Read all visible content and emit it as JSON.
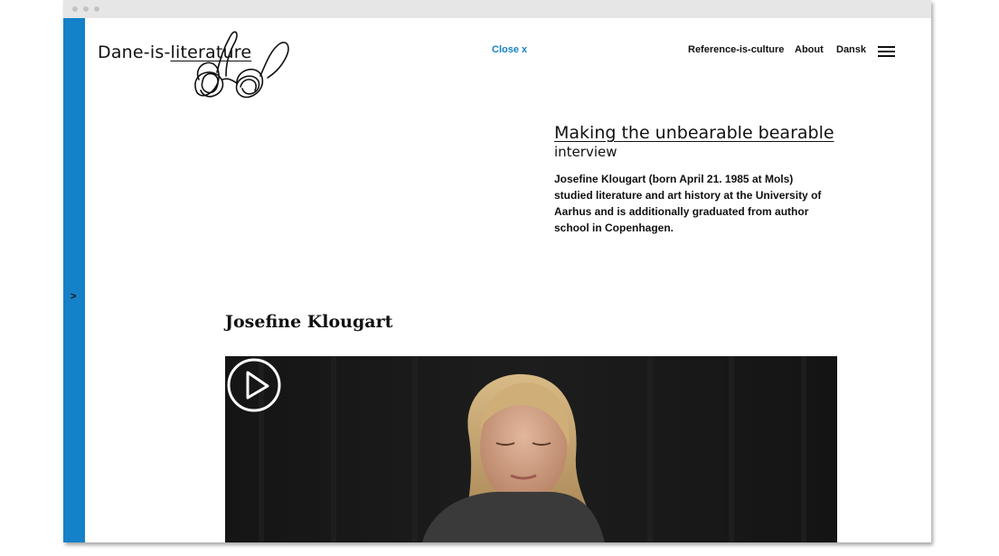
{
  "brand": {
    "logo_prefix": "Dane-is-",
    "logo_underlined": "literature"
  },
  "header": {
    "close_label": "Close x",
    "nav": [
      {
        "label": "Reference-is-culture"
      },
      {
        "label": "About"
      },
      {
        "label": "Dansk"
      }
    ],
    "menu_icon": "hamburger-icon"
  },
  "sidebar": {
    "toggle_glyph": ">",
    "color": "#1581c8"
  },
  "article": {
    "title": "Making the unbearable bearable",
    "kind": "interview",
    "bio": "Josefine Klougart (born April 21. 1985 at Mols) studied literature and art history at the University of Aarhus and is additionally graduated from author school in Copenhagen."
  },
  "author": {
    "name": "Josefine Klougart"
  },
  "video": {
    "play_icon": "play-icon"
  },
  "colors": {
    "accent": "#1581c8",
    "text": "#111111",
    "video_bg": "#111111"
  }
}
